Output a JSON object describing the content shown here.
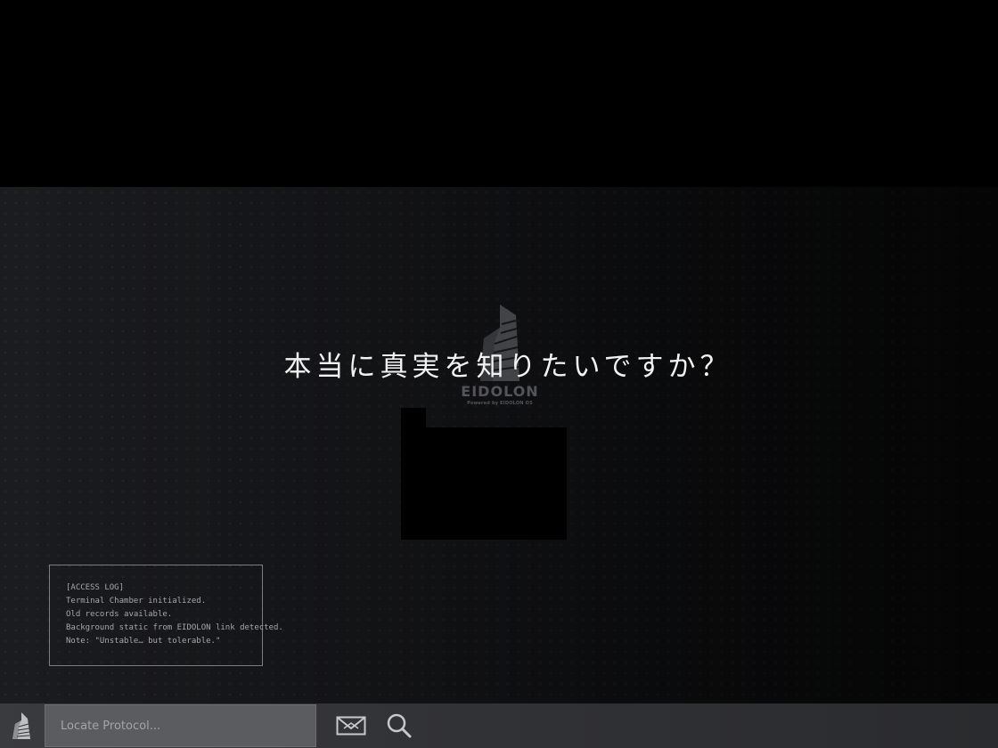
{
  "overlay": {
    "question": "本当に真実を知りたいですか？"
  },
  "logo": {
    "name": "EIDOLON",
    "tagline": "Powered by EIDOLON OS"
  },
  "access_log": {
    "lines": [
      "[ACCESS LOG]",
      "Terminal Chamber initialized.",
      "Old records available.",
      "Background static from EIDOLON link detected.",
      "Note: \"Unstable… but tolerable.\""
    ]
  },
  "taskbar": {
    "search_placeholder": "Locate Protocol...",
    "start_icon": "tower-icon",
    "mail_icon": "envelope-icon",
    "search_icon": "magnifier-icon"
  },
  "colors": {
    "background": "#000000",
    "desktop": "#17181b",
    "taskbar": "#333437",
    "text_primary": "#f2f2f2",
    "text_muted": "#a6a7ab"
  }
}
